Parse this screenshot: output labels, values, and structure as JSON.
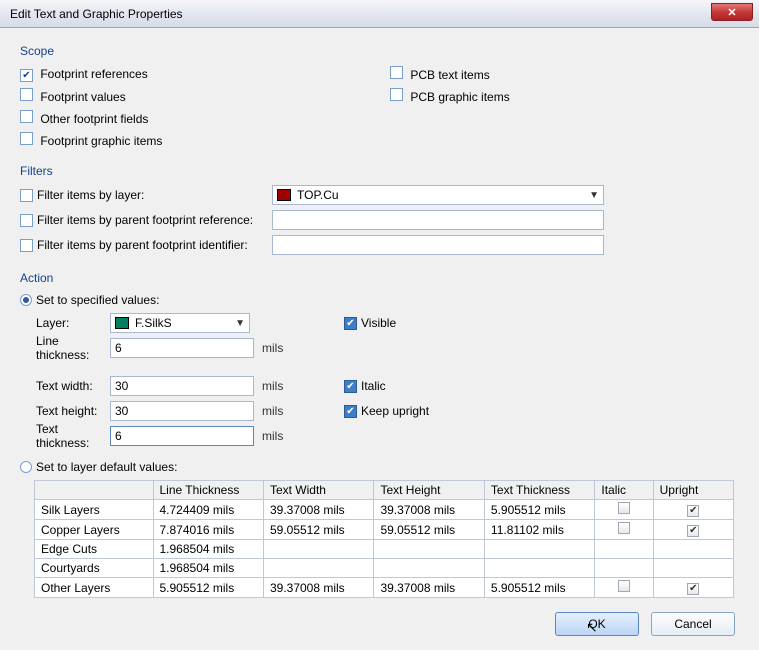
{
  "window": {
    "title": "Edit Text and Graphic Properties"
  },
  "scope": {
    "heading": "Scope",
    "footprint_references": "Footprint references",
    "footprint_values": "Footprint values",
    "other_footprint_fields": "Other footprint fields",
    "footprint_graphic_items": "Footprint graphic items",
    "pcb_text_items": "PCB text items",
    "pcb_graphic_items": "PCB graphic items"
  },
  "filters": {
    "heading": "Filters",
    "by_layer": "Filter items by layer:",
    "by_parent_ref": "Filter items by parent footprint reference:",
    "by_parent_id": "Filter items by parent footprint identifier:",
    "layer_select": "TOP.Cu",
    "parent_ref_value": "",
    "parent_id_value": ""
  },
  "action": {
    "heading": "Action",
    "set_specified": "Set to specified values:",
    "set_defaults": "Set to layer default values:",
    "layer_label": "Layer:",
    "layer_value": "F.SilkS",
    "line_thickness_label": "Line thickness:",
    "line_thickness_value": "6",
    "text_width_label": "Text width:",
    "text_width_value": "30",
    "text_height_label": "Text height:",
    "text_height_value": "30",
    "text_thickness_label": "Text thickness:",
    "text_thickness_value": "6",
    "unit": "mils",
    "visible": "Visible",
    "italic": "Italic",
    "keep_upright": "Keep upright"
  },
  "defaults_table": {
    "headers": {
      "row": "",
      "line_thickness": "Line Thickness",
      "text_width": "Text Width",
      "text_height": "Text Height",
      "text_thickness": "Text Thickness",
      "italic": "Italic",
      "upright": "Upright"
    },
    "rows": [
      {
        "name": "Silk Layers",
        "lt": "4.724409 mils",
        "tw": "39.37008 mils",
        "th": "39.37008 mils",
        "tt": "5.905512 mils",
        "italic": false,
        "upright": true,
        "show_cb": true
      },
      {
        "name": "Copper Layers",
        "lt": "7.874016 mils",
        "tw": "59.05512 mils",
        "th": "59.05512 mils",
        "tt": "11.81102 mils",
        "italic": false,
        "upright": true,
        "show_cb": true
      },
      {
        "name": "Edge Cuts",
        "lt": "1.968504 mils",
        "tw": "",
        "th": "",
        "tt": "",
        "italic": false,
        "upright": false,
        "show_cb": false
      },
      {
        "name": "Courtyards",
        "lt": "1.968504 mils",
        "tw": "",
        "th": "",
        "tt": "",
        "italic": false,
        "upright": false,
        "show_cb": false
      },
      {
        "name": "Other Layers",
        "lt": "5.905512 mils",
        "tw": "39.37008 mils",
        "th": "39.37008 mils",
        "tt": "5.905512 mils",
        "italic": false,
        "upright": true,
        "show_cb": true
      }
    ]
  },
  "buttons": {
    "ok": "OK",
    "cancel": "Cancel"
  }
}
